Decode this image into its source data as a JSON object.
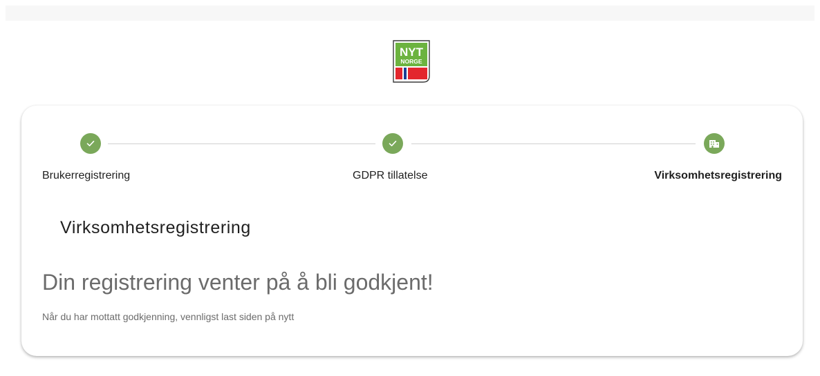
{
  "logo": {
    "line1": "NYT",
    "line2": "NORGE",
    "colors": {
      "green": "#6cb33f",
      "red": "#e3262d",
      "blue": "#1c3f94"
    }
  },
  "stepper": {
    "accent": "#7aa85a",
    "steps": [
      {
        "label": "Brukerregistrering",
        "state": "completed",
        "icon": "check-icon"
      },
      {
        "label": "GDPR tillatelse",
        "state": "completed",
        "icon": "check-icon"
      },
      {
        "label": "Virksomhetsregistrering",
        "state": "active",
        "icon": "business-icon"
      }
    ]
  },
  "main": {
    "section_title": "Virksomhetsregistrering",
    "headline": "Din registrering venter på å bli godkjent!",
    "subtext": "Når du har mottatt godkjenning, vennligst last siden på nytt"
  }
}
